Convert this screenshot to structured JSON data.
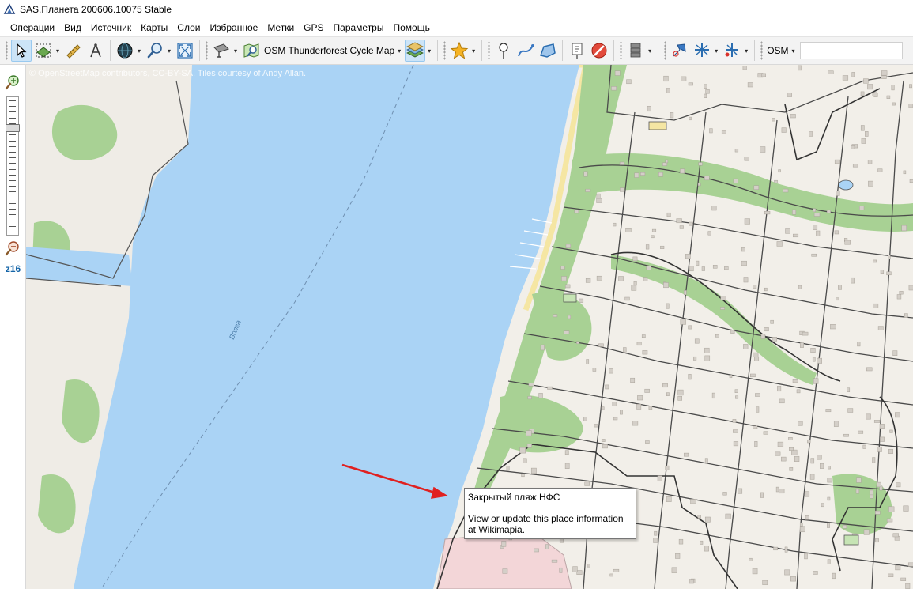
{
  "window": {
    "title": "SAS.Планета 200606.10075 Stable"
  },
  "menu": {
    "items": [
      "Операции",
      "Вид",
      "Источник",
      "Карты",
      "Слои",
      "Избранное",
      "Метки",
      "GPS",
      "Параметры",
      "Помощь"
    ]
  },
  "toolbar": {
    "map_source_label": "OSM Thunderforest Cycle Map",
    "osm_label": "OSM",
    "icons": [
      "cursor-icon",
      "select-area-icon",
      "ruler-icon",
      "compass-icon",
      "globe-icon",
      "search-icon",
      "fullscreen-icon",
      "satellite-icon",
      "map-search-icon",
      "layers-icon",
      "favorite-star-icon",
      "placemark-icon",
      "path-icon",
      "polygon-icon",
      "marks-visibility-icon",
      "stop-icon",
      "database-icon",
      "gps-icon",
      "gps-track-icon",
      "gps-record-icon"
    ]
  },
  "zoom": {
    "level_label": "z16",
    "level": 16,
    "min": 1,
    "max": 24
  },
  "map": {
    "attribution": "© OpenStreetMap contributors, CC-BY-SA. Tiles courtesy of Andy Allan.",
    "river_label": "Волга",
    "colors": {
      "water": "#aad3f5",
      "land": "#f2efe9",
      "forest": "#a8d194",
      "industrial": "#f3d6d8",
      "road_casing": "#4a4a4a",
      "sand": "#f5e6a3"
    }
  },
  "tooltip": {
    "title": "Закрытый пляж НФС",
    "body": "View or update this place information at Wikimapia."
  },
  "annotation": {
    "arrow_color": "#e02020"
  }
}
